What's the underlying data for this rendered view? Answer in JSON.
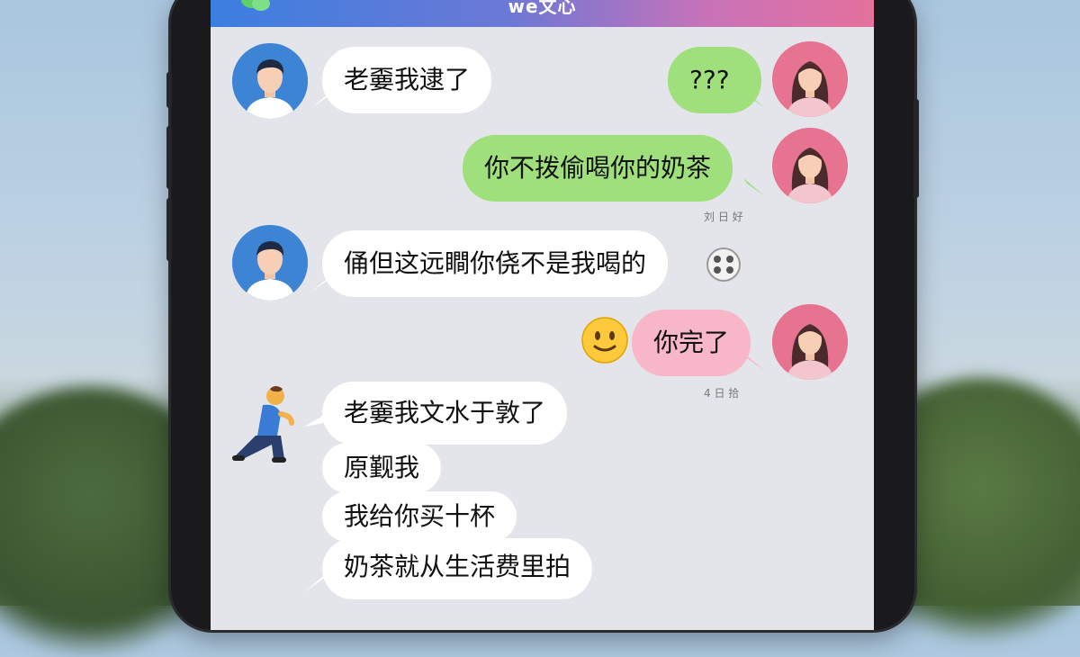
{
  "app": {
    "title": "we文心"
  },
  "messages": [
    {
      "sender": "boyfriend",
      "text": "老嫑我逮了"
    },
    {
      "sender": "girlfriend",
      "text": "???"
    },
    {
      "sender": "girlfriend",
      "text": "你不拨偷喝你的奶茶"
    },
    {
      "sender": "boyfriend",
      "text": "俑但这远瞷你侥不是我喝的"
    },
    {
      "sender": "girlfriend",
      "text": "你完了",
      "emoji": "🙂"
    },
    {
      "sender": "boyfriend",
      "texts": [
        "老嫑我文水于敦了",
        "原觐我",
        "我给你买十杯",
        "奶茶就从生活费里拍"
      ]
    }
  ],
  "timestamps": [
    "刘 日 好",
    "4 日 拾"
  ],
  "colors": {
    "header_start": "#3b7fe0",
    "header_end": "#e5719c",
    "bubble_green": "#9fe07c",
    "bubble_pink": "#f7b7c8",
    "bubble_white": "#ffffff",
    "screen_bg": "#e3e5ea"
  },
  "icons": {
    "header_logo": "wechat-logo",
    "typing_indicator": "film-reel-icon",
    "emoji_smile": "slightly-smiling-face",
    "kneeling_person": "kneeling-person-emoji"
  }
}
